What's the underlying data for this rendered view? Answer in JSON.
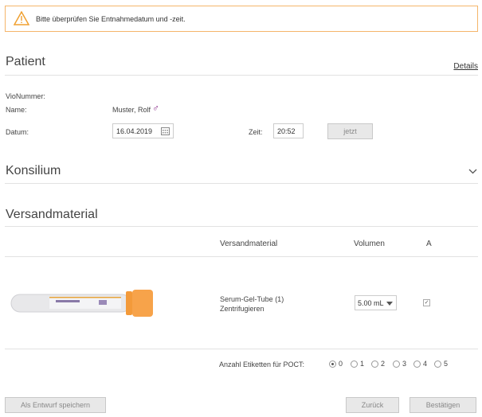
{
  "alert": {
    "message": "Bitte überprüfen Sie Entnahmedatum und -zeit.",
    "icon": "warning-icon"
  },
  "patient": {
    "title": "Patient",
    "details_link": "Details",
    "vio_label": "VioNummer:",
    "vio_value": "",
    "name_label": "Name:",
    "name_value": "Muster, Rolf",
    "gender_symbol": "♂",
    "date_label": "Datum:",
    "date_value": "16.04.2019",
    "time_label": "Zeit:",
    "time_value": "20:52",
    "now_button": "jetzt"
  },
  "konsilium": {
    "title": "Konsilium"
  },
  "versand": {
    "title": "Versandmaterial",
    "columns": [
      "Versandmaterial",
      "Volumen",
      "A"
    ],
    "rows": [
      {
        "name": "Serum-Gel-Tube (1)",
        "note": "Zentrifugieren",
        "volume": "5.00 mL",
        "checked": true
      }
    ],
    "poct_label": "Anzahl Etiketten für POCT:",
    "poct_options": [
      "0",
      "1",
      "2",
      "3",
      "4",
      "5"
    ],
    "poct_selected": "0"
  },
  "footer": {
    "draft_button": "Als Entwurf speichern",
    "back_button": "Zurück",
    "confirm_button": "Bestätigen"
  },
  "colors": {
    "alert_border": "#f5b56a",
    "tube_cap": "#f7a34a",
    "gender": "#8b2f8b"
  }
}
